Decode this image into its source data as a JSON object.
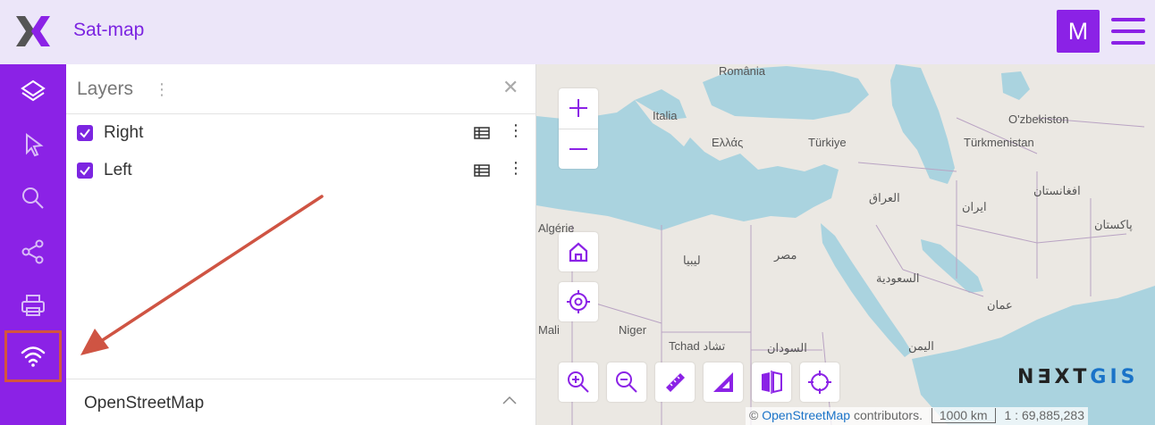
{
  "header": {
    "app_title": "Sat-map",
    "user_initial": "M",
    "accent_color": "#8b22e6",
    "background_color": "#ece6f9"
  },
  "toolbar": {
    "items": [
      {
        "icon": "layers-icon"
      },
      {
        "icon": "pointer-icon"
      },
      {
        "icon": "search-icon"
      },
      {
        "icon": "share-icon"
      },
      {
        "icon": "print-icon"
      },
      {
        "icon": "wifi-icon",
        "highlighted": true
      }
    ]
  },
  "layers_panel": {
    "title": "Layers",
    "layers": [
      {
        "name": "Right",
        "checked": true
      },
      {
        "name": "Left",
        "checked": true
      }
    ],
    "basemap": "OpenStreetMap"
  },
  "map": {
    "places": [
      "România",
      "Italia",
      "Ελλάς",
      "Türkiye",
      "O'zbekiston",
      "Türkmenistan",
      "Algérie",
      "ليبيا",
      "مصر",
      "العراق",
      "ایران",
      "افغانستان",
      "پاکستان",
      "السعودية",
      "عمان",
      "Mali",
      "Niger",
      "Tchad تشاد",
      "السودان",
      "اليمن"
    ],
    "brand_prefix": "N∃XT",
    "brand_suffix": "GIS",
    "attribution_prefix": "© ",
    "attribution_link": "OpenStreetMap",
    "attribution_suffix": " contributors.",
    "scale_label": "1000 km",
    "scale_ratio": "1 : 69,885,283"
  }
}
